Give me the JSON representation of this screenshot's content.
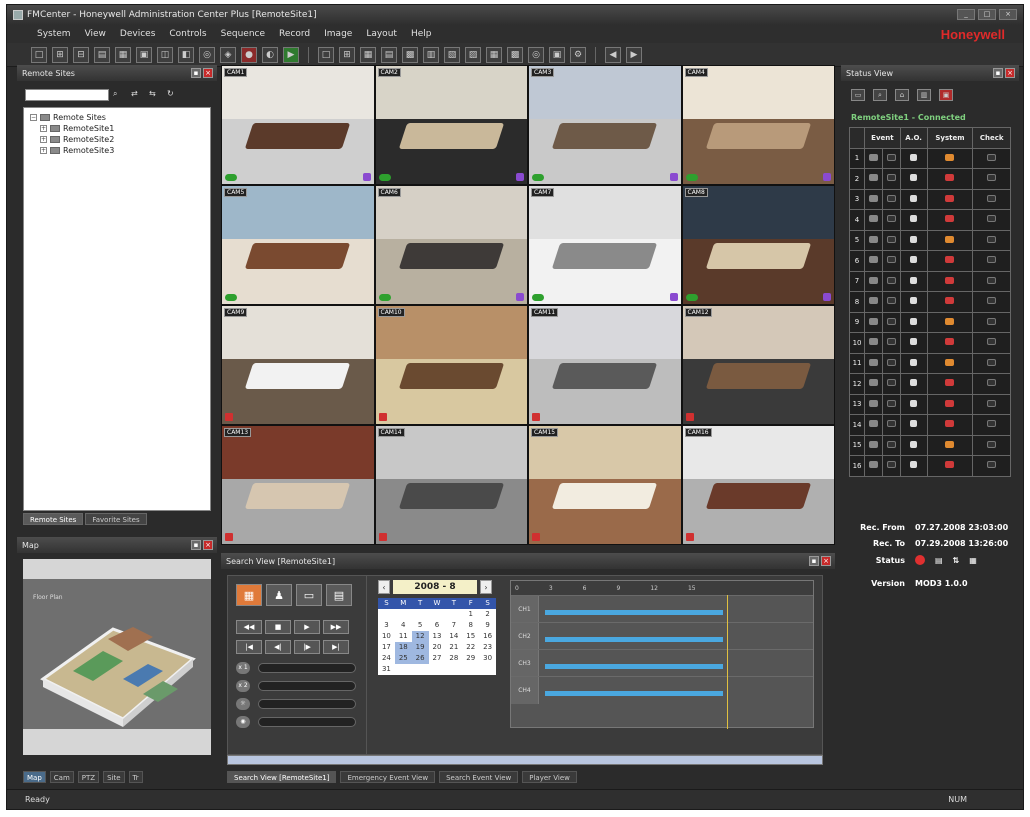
{
  "window": {
    "title": "FMCenter - Honeywell Administration Center Plus [RemoteSite1]"
  },
  "menu": [
    "System",
    "View",
    "Devices",
    "Controls",
    "Sequence",
    "Record",
    "Image",
    "Layout",
    "Help"
  ],
  "brand": "Honeywell",
  "site_view": {
    "title": "Remote Sites",
    "search_placeholder": "",
    "tree": {
      "root": "Remote Sites",
      "children": [
        "RemoteSite1",
        "RemoteSite2",
        "RemoteSite3"
      ]
    },
    "tabs": [
      "Remote Sites",
      "Favorite Sites"
    ]
  },
  "map_view": {
    "title": "Map",
    "map_caption": "Floor Plan",
    "tabs": [
      "Map",
      "Cam",
      "PTZ",
      "Site",
      "Tr"
    ]
  },
  "cameras": [
    {
      "label": "CAM1",
      "dot": "green",
      "purple": true
    },
    {
      "label": "CAM2",
      "dot": "green",
      "purple": true
    },
    {
      "label": "CAM3",
      "dot": "green",
      "purple": true
    },
    {
      "label": "CAM4",
      "dot": "green",
      "purple": true
    },
    {
      "label": "CAM5",
      "dot": "green",
      "purple": false
    },
    {
      "label": "CAM6",
      "dot": "green",
      "purple": true
    },
    {
      "label": "CAM7",
      "dot": "green",
      "purple": true
    },
    {
      "label": "CAM8",
      "dot": "green",
      "purple": true
    },
    {
      "label": "CAM9",
      "dot": "red",
      "purple": false
    },
    {
      "label": "CAM10",
      "dot": "red",
      "purple": false
    },
    {
      "label": "CAM11",
      "dot": "red",
      "purple": false
    },
    {
      "label": "CAM12",
      "dot": "red",
      "purple": false
    },
    {
      "label": "CAM13",
      "dot": "red",
      "purple": false
    },
    {
      "label": "CAM14",
      "dot": "red",
      "purple": false
    },
    {
      "label": "CAM15",
      "dot": "red",
      "purple": false
    },
    {
      "label": "CAM16",
      "dot": "red",
      "purple": false
    }
  ],
  "search_view": {
    "title": "Search View [RemoteSite1]",
    "calendar": {
      "month_label": "2008 - 8",
      "dow": [
        "S",
        "M",
        "T",
        "W",
        "T",
        "F",
        "S"
      ],
      "days": [
        "",
        "",
        "",
        "",
        "",
        "1",
        "2",
        "3",
        "4",
        "5",
        "6",
        "7",
        "8",
        "9",
        "10",
        "11",
        "12",
        "13",
        "14",
        "15",
        "16",
        "17",
        "18",
        "19",
        "20",
        "21",
        "22",
        "23",
        "24",
        "25",
        "26",
        "27",
        "28",
        "29",
        "30",
        "31"
      ]
    },
    "playback_row1": [
      "◀◀",
      "■",
      "▶",
      "▶▶"
    ],
    "playback_row2": [
      "|◀",
      "◀|",
      "|▶",
      "▶|"
    ],
    "sliders": [
      "x 1",
      "x 2",
      "",
      ""
    ],
    "timeline_rows": [
      "CH1",
      "CH2",
      "CH3",
      "CH4"
    ],
    "tabs": [
      "Search View [RemoteSite1]",
      "Emergency Event View",
      "Search Event View",
      "Player View"
    ]
  },
  "status_view": {
    "title": "Status View",
    "site_status": "RemoteSite1 - Connected",
    "headers": [
      "",
      "Event",
      "A.O.",
      "System",
      "Check"
    ],
    "channels": [
      "1",
      "2",
      "3",
      "4",
      "5",
      "6",
      "7",
      "8",
      "9",
      "10",
      "11",
      "12",
      "13",
      "14",
      "15",
      "16"
    ],
    "rec_from_label": "Rec. From",
    "rec_from_value": "07.27.2008 23:03:00",
    "rec_to_label": "Rec. To",
    "rec_to_value": "07.29.2008 13:26:00",
    "status_label": "Status",
    "version_label": "Version",
    "version_value": "MOD3 1.0.0"
  },
  "statusbar": {
    "ready": "Ready",
    "right": "NUM"
  }
}
